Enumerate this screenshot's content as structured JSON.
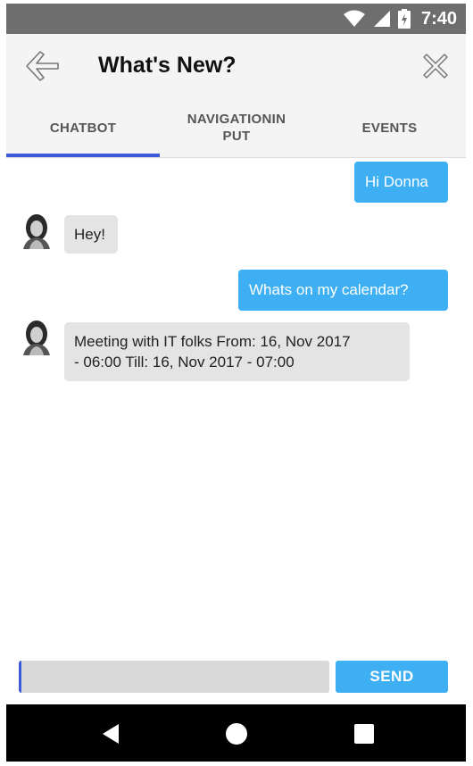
{
  "status_bar": {
    "time": "7:40"
  },
  "header": {
    "title": "What's New?"
  },
  "tabs": [
    {
      "label": "CHATBOT",
      "active": true
    },
    {
      "label": "NAVIGATIONINPUT",
      "line1": "NAVIGATIONIN",
      "line2": "PUT",
      "active": false
    },
    {
      "label": "EVENTS",
      "active": false
    }
  ],
  "messages": [
    {
      "from": "user",
      "text": "Hi Donna"
    },
    {
      "from": "bot",
      "text": "Hey!"
    },
    {
      "from": "user",
      "text": "Whats on my calendar?"
    },
    {
      "from": "bot",
      "line1": "Meeting with IT folks From: 16, Nov 2017",
      "line2": "- 06:00 Till: 16, Nov 2017 - 07:00"
    }
  ],
  "composer": {
    "value": "",
    "send_label": "SEND"
  },
  "colors": {
    "accent": "#3eaff2",
    "tab_indicator": "#3b5bdb",
    "bot_bubble": "#e4e4e4"
  },
  "icons": {
    "back": "arrow-left-icon",
    "close": "close-icon",
    "wifi": "wifi-icon",
    "signal": "signal-icon",
    "battery": "battery-icon",
    "nav_back": "triangle-back-icon",
    "nav_home": "circle-home-icon",
    "nav_recents": "square-recents-icon"
  }
}
